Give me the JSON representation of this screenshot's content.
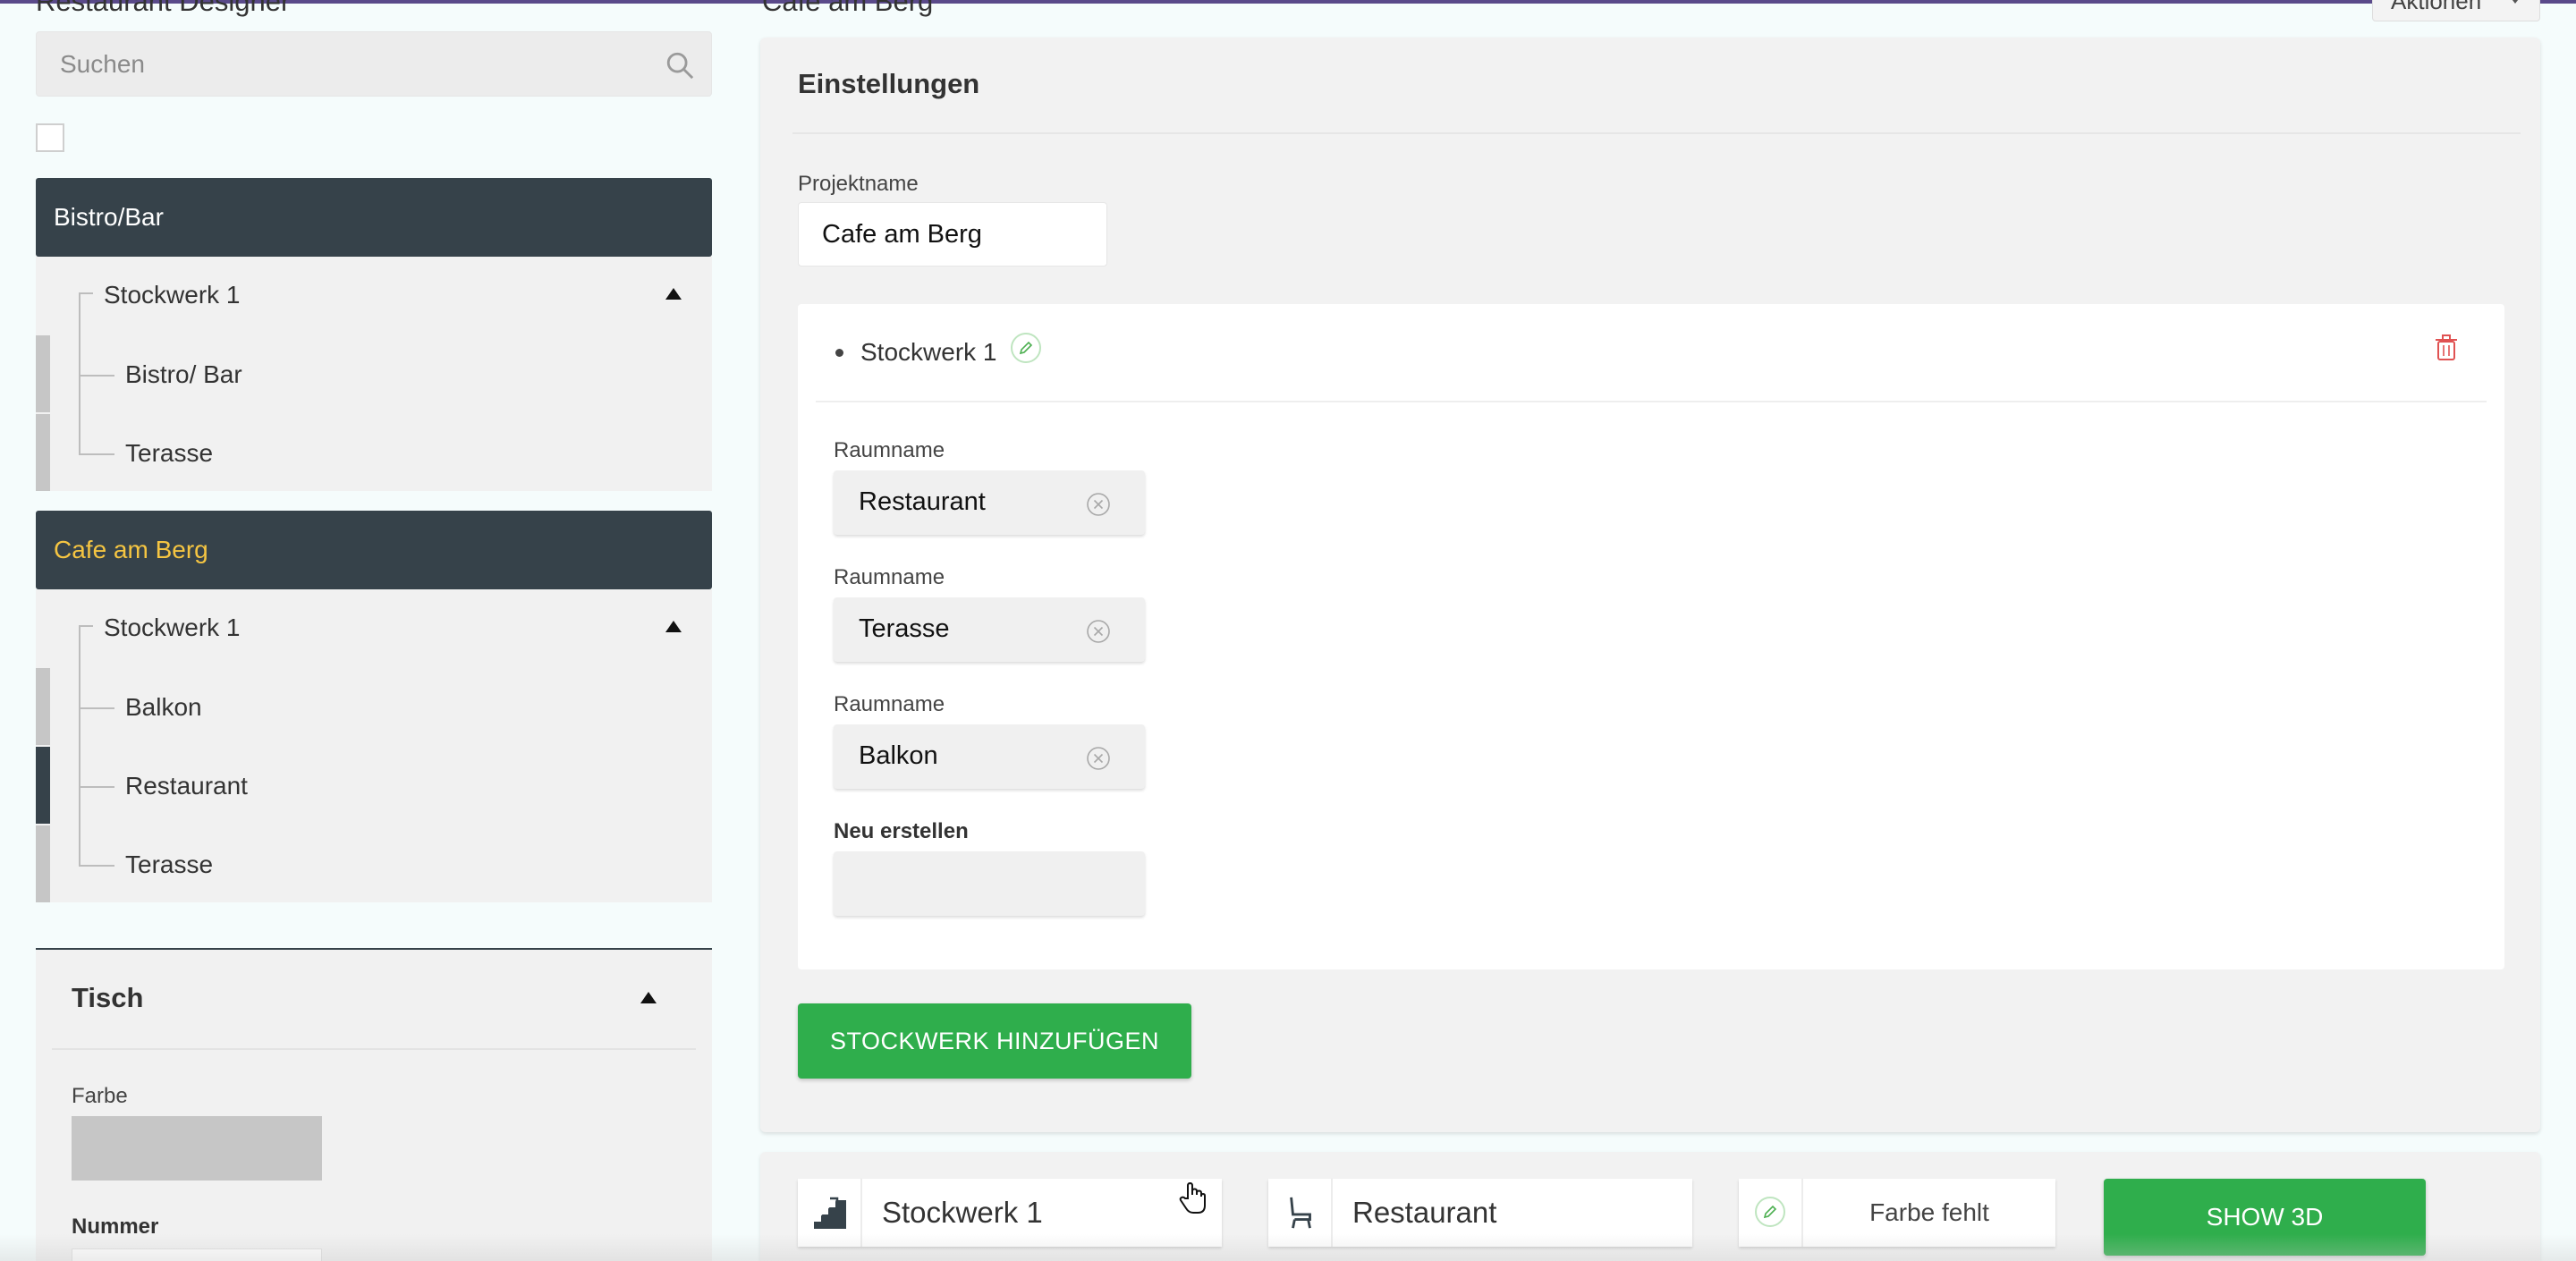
{
  "sidebar": {
    "app_title": "Restaurant Designer",
    "search": {
      "placeholder": "Suchen",
      "value": ""
    },
    "groups": [
      {
        "name": "Bistro/Bar",
        "active": false,
        "floors": [
          {
            "name": "Stockwerk 1",
            "rooms": [
              "Bistro/ Bar",
              "Terasse"
            ]
          }
        ]
      },
      {
        "name": "Cafe am Berg",
        "active": true,
        "floors": [
          {
            "name": "Stockwerk 1",
            "rooms": [
              "Balkon",
              "Restaurant",
              "Terasse"
            ]
          }
        ]
      }
    ],
    "tisch": {
      "title": "Tisch",
      "color_label": "Farbe",
      "number_label": "Nummer"
    }
  },
  "main": {
    "page_title": "Cafe am Berg",
    "actions_label": "Aktionen",
    "settings": {
      "title": "Einstellungen",
      "project_label": "Projektname",
      "project_value": "Cafe am Berg",
      "floor": {
        "name": "Stockwerk 1",
        "room_label": "Raumname",
        "rooms": [
          "Restaurant",
          "Terasse",
          "Balkon"
        ],
        "new_label": "Neu erstellen"
      },
      "add_floor_label": "STOCKWERK HINZUFÜGEN"
    },
    "bottom_bar": {
      "floor_select": "Stockwerk 1",
      "room_select": "Restaurant",
      "color_status": "Farbe fehlt",
      "show3d_label": "SHOW 3D"
    }
  },
  "colors": {
    "dark_header": "#36424a",
    "active_text": "#f5c542",
    "accent_green": "#2fae4c",
    "danger_red": "#e05252"
  }
}
